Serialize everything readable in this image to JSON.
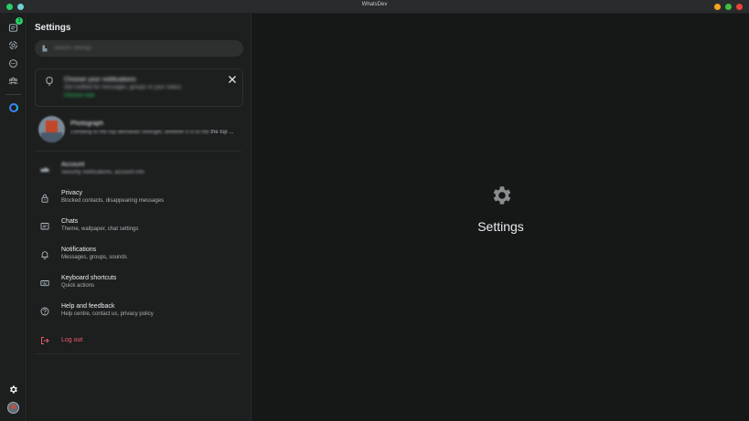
{
  "window": {
    "title": "WhatsDev"
  },
  "rail": {
    "chats_badge": "3"
  },
  "settings": {
    "title": "Settings",
    "search_placeholder": "Search settings"
  },
  "notification_card": {
    "title": "Choose your notifications",
    "description": "Get notified for messages, groups or your status",
    "link": "Choose now"
  },
  "profile": {
    "name": "Photograph",
    "about_hidden": "Climbing to the top demands strength, whether it is to the",
    "about_visible": "the top ..."
  },
  "menu": [
    {
      "label": "Account",
      "desc": "Security notifications, account info",
      "icon": "key-icon",
      "blurred": true
    },
    {
      "label": "Privacy",
      "desc": "Blocked contacts, disappearing messages",
      "icon": "lock-icon"
    },
    {
      "label": "Chats",
      "desc": "Theme, wallpaper, chat settings",
      "icon": "chat-icon"
    },
    {
      "label": "Notifications",
      "desc": "Messages, groups, sounds",
      "icon": "bell-icon"
    },
    {
      "label": "Keyboard shortcuts",
      "desc": "Quick actions",
      "icon": "keyboard-icon"
    },
    {
      "label": "Help and feedback",
      "desc": "Help centre, contact us, privacy policy",
      "icon": "help-icon"
    }
  ],
  "logout": {
    "label": "Log out",
    "color": "#f15c6d"
  },
  "main": {
    "title": "Settings"
  },
  "colors": {
    "accent": "#25d366",
    "background": "#161717",
    "panel": "#1d1f1f"
  }
}
